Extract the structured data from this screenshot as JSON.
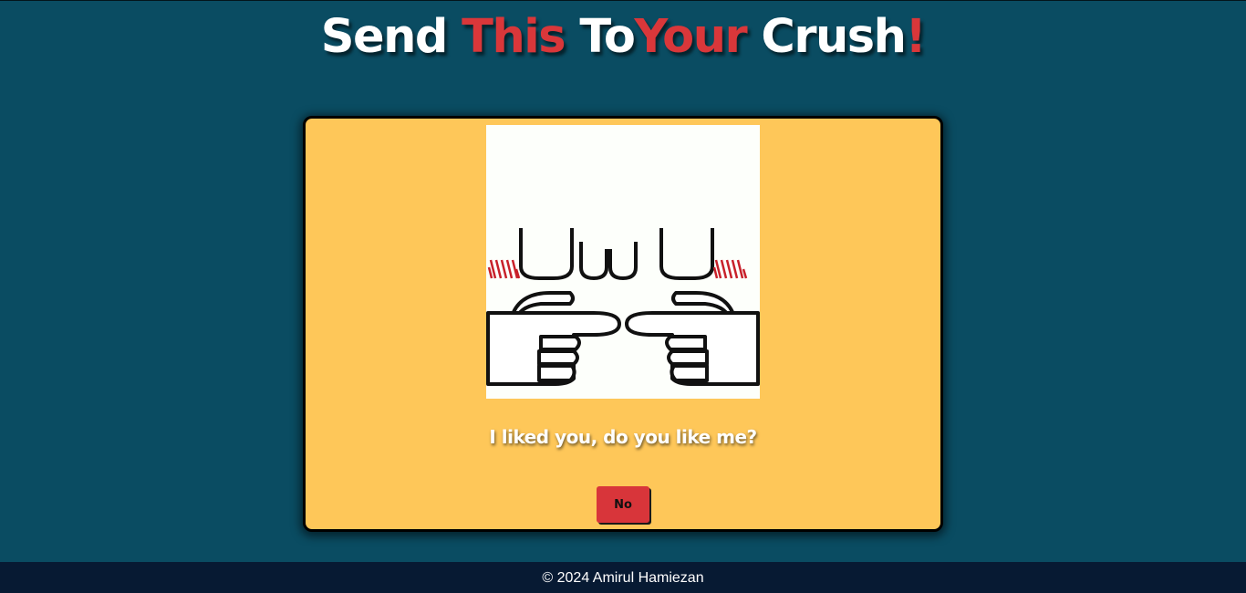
{
  "header": {
    "title_parts": [
      {
        "text": "Send ",
        "color": "#ffffff"
      },
      {
        "text": "This",
        "color": "#d9373a"
      },
      {
        "text": " To",
        "color": "#ffffff"
      },
      {
        "text": "Your",
        "color": "#d9373a"
      },
      {
        "text": " Crush",
        "color": "#ffffff"
      },
      {
        "text": "!",
        "color": "#d9373a"
      }
    ]
  },
  "card": {
    "image_name": "uwu-pointing-fingers-gif",
    "question": "I liked you, do you like me?",
    "no_button_label": "No"
  },
  "footer": {
    "copyright": "© 2024 Amirul Hamiezan"
  },
  "colors": {
    "background": "#0a4c62",
    "card": "#fec759",
    "accent_red": "#d9373a",
    "footer": "#071a33"
  }
}
